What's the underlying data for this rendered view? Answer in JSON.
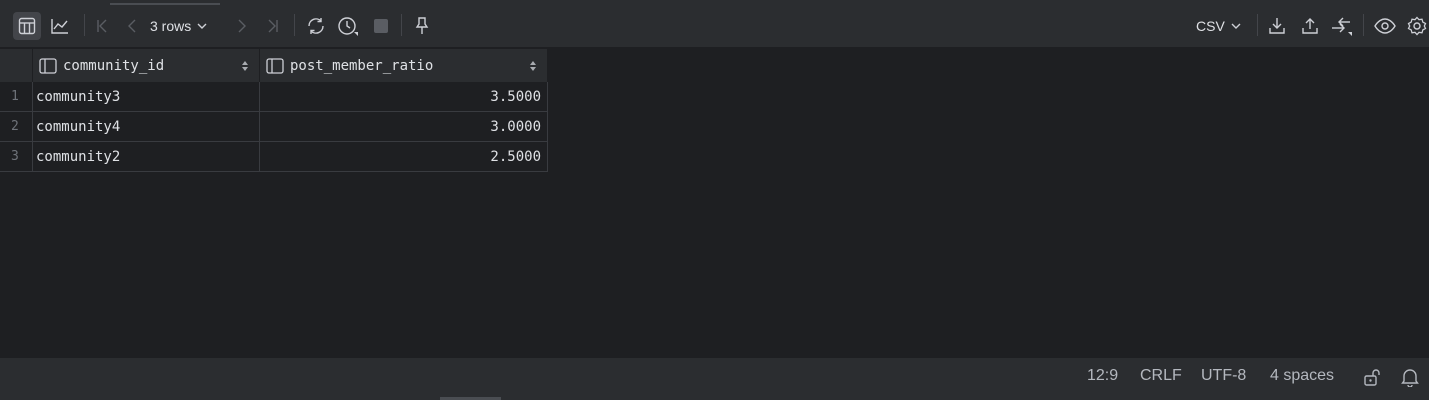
{
  "toolbar": {
    "rows_label": "3 rows",
    "export_format": "CSV",
    "icons": [
      "table-view-icon",
      "chart-view-icon",
      "first-page-icon",
      "previous-page-icon",
      "next-page-icon",
      "last-page-icon",
      "refresh-icon",
      "history-icon",
      "stop-icon",
      "pin-icon",
      "download-icon",
      "upload-icon",
      "compare-icon",
      "view-icon",
      "settings-icon"
    ]
  },
  "table": {
    "columns": [
      {
        "name": "community_id"
      },
      {
        "name": "post_member_ratio"
      }
    ],
    "rows": [
      {
        "num": "1",
        "community_id": "community3",
        "post_member_ratio": "3.5000"
      },
      {
        "num": "2",
        "community_id": "community4",
        "post_member_ratio": "3.0000"
      },
      {
        "num": "3",
        "community_id": "community2",
        "post_member_ratio": "2.5000"
      }
    ]
  },
  "statusbar": {
    "position": "12:9",
    "line_ending": "CRLF",
    "encoding": "UTF-8",
    "indent": "4 spaces"
  },
  "colors": {
    "background": "#1e1f22",
    "toolbar": "#2b2d30",
    "text": "#dfe1e5",
    "muted": "#6f737a"
  }
}
